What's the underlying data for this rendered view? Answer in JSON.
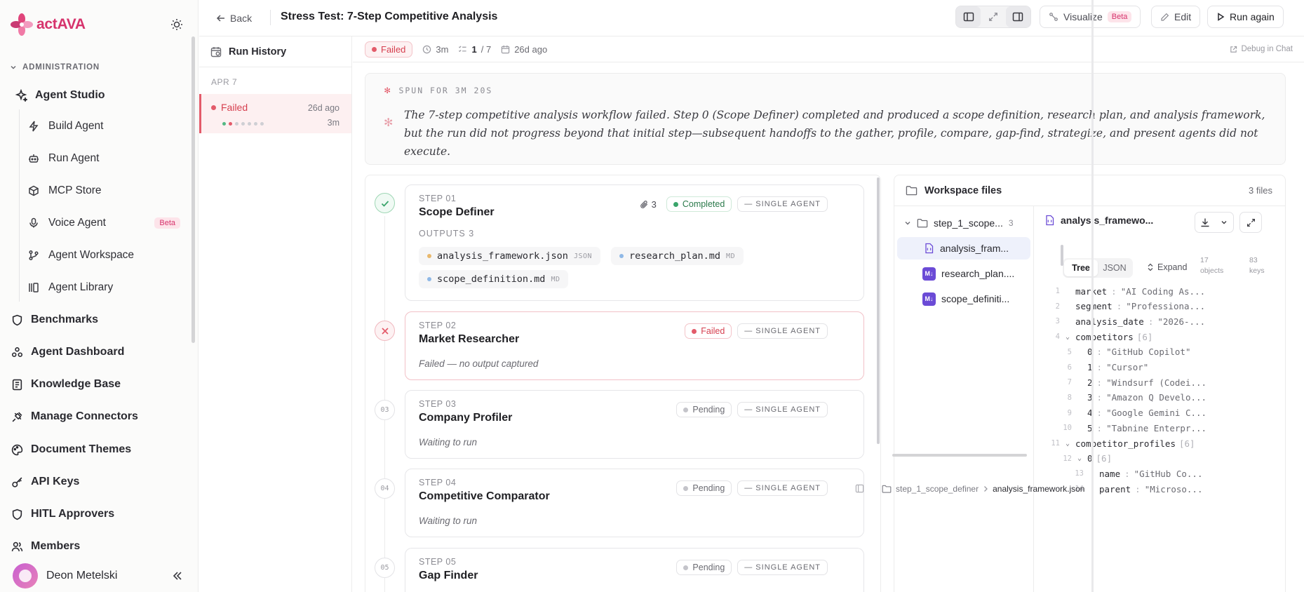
{
  "brand": {
    "name_part1": "act",
    "name_part2": "AVA",
    "accent": "#d6336c"
  },
  "sidebar": {
    "section_label": "ADMINISTRATION",
    "agent_studio_label": "Agent Studio",
    "sub_items": [
      {
        "label": "Build Agent",
        "icon": "bolt-icon"
      },
      {
        "label": "Run Agent",
        "icon": "robot-icon"
      },
      {
        "label": "MCP Store",
        "icon": "cube-icon"
      },
      {
        "label": "Voice Agent",
        "icon": "mic-icon",
        "badge": "Beta"
      },
      {
        "label": "Agent Workspace",
        "icon": "branch-icon"
      },
      {
        "label": "Agent Library",
        "icon": "library-icon"
      }
    ],
    "items": [
      {
        "label": "Benchmarks",
        "icon": "shield-icon"
      },
      {
        "label": "Agent Dashboard",
        "icon": "dashboard-icon"
      },
      {
        "label": "Knowledge Base",
        "icon": "book-icon"
      },
      {
        "label": "Manage Connectors",
        "icon": "plug-icon"
      },
      {
        "label": "Document Themes",
        "icon": "palette-icon"
      },
      {
        "label": "API Keys",
        "icon": "key-icon"
      },
      {
        "label": "HITL Approvers",
        "icon": "shield-check-icon"
      },
      {
        "label": "Members",
        "icon": "users-icon"
      }
    ],
    "user_name": "Deon Metelski"
  },
  "topbar": {
    "back_label": "Back",
    "title": "Stress Test: 7-Step Competitive Analysis",
    "visualize_label": "Visualize",
    "visualize_badge": "Beta",
    "edit_label": "Edit",
    "run_again_label": "Run again"
  },
  "run_history": {
    "title": "Run History",
    "date_group": "APR 7",
    "run": {
      "status": "Failed",
      "age": "26d ago",
      "duration": "3m"
    }
  },
  "run_meta": {
    "status": "Failed",
    "duration": "3m",
    "steps_done": "1",
    "steps_total": "/ 7",
    "age": "26d ago",
    "debug_label": "Debug in Chat"
  },
  "summary": {
    "heading": "SPUN FOR 3M 20S",
    "text": "The 7-step competitive analysis workflow failed. Step 0 (Scope Definer) completed and produced a scope definition, research plan, and analysis framework, but the run did not progress beyond that initial step—subsequent handoffs to the gather, profile, compare, gap-find, strategize, and present agents did not execute."
  },
  "steps": [
    {
      "num": "STEP 01",
      "name": "Scope Definer",
      "status": "Completed",
      "agent": "SINGLE AGENT",
      "attach_count": "3",
      "outputs_label": "OUTPUTS",
      "outputs_count": "3",
      "outputs": [
        {
          "name": "analysis_framework.json",
          "ext": "JSON",
          "color": "#e8b86d"
        },
        {
          "name": "research_plan.md",
          "ext": "MD",
          "color": "#8fb8e6"
        },
        {
          "name": "scope_definition.md",
          "ext": "MD",
          "color": "#8fb8e6"
        }
      ]
    },
    {
      "num": "STEP 02",
      "name": "Market Researcher",
      "status": "Failed",
      "agent": "SINGLE AGENT",
      "note": "Failed — no output captured"
    },
    {
      "num": "STEP 03",
      "name": "Company Profiler",
      "status": "Pending",
      "agent": "SINGLE AGENT",
      "note": "Waiting to run",
      "marker": "03"
    },
    {
      "num": "STEP 04",
      "name": "Competitive Comparator",
      "status": "Pending",
      "agent": "SINGLE AGENT",
      "note": "Waiting to run",
      "marker": "04"
    },
    {
      "num": "STEP 05",
      "name": "Gap Finder",
      "status": "Pending",
      "agent": "SINGLE AGENT",
      "marker": "05"
    }
  ],
  "workspace": {
    "title": "Workspace files",
    "count": "3 files",
    "folder": {
      "name": "step_1_scope...",
      "count": "3"
    },
    "files": [
      {
        "name": "analysis_fram...",
        "type": "json"
      },
      {
        "name": "research_plan....",
        "type": "md"
      },
      {
        "name": "scope_definiti...",
        "type": "md"
      }
    ],
    "viewer_title": "analysis_framewo...",
    "tab_tree": "Tree",
    "tab_json": "JSON",
    "expand_label": "Expand",
    "stat_objects_n": "17",
    "stat_objects_label": "objects",
    "stat_keys_n": "83",
    "stat_keys_label": "keys",
    "breadcrumb_folder": "step_1_scope_definer",
    "breadcrumb_file": "analysis_framework.json",
    "json_lines": [
      {
        "n": "1",
        "key": "market",
        "val": "\"AI Coding As..."
      },
      {
        "n": "2",
        "key": "segment",
        "val": "\"Professiona..."
      },
      {
        "n": "3",
        "key": "analysis_date",
        "val": "\"2026-..."
      },
      {
        "n": "4",
        "key": "competitors",
        "bracket": "[6]"
      },
      {
        "n": "5",
        "key": "0",
        "val": "\"GitHub Copilot\""
      },
      {
        "n": "6",
        "key": "1",
        "val": "\"Cursor\""
      },
      {
        "n": "7",
        "key": "2",
        "val": "\"Windsurf (Codei..."
      },
      {
        "n": "8",
        "key": "3",
        "val": "\"Amazon Q Develo..."
      },
      {
        "n": "9",
        "key": "4",
        "val": "\"Google Gemini C..."
      },
      {
        "n": "10",
        "key": "5",
        "val": "\"Tabnine Enterpr..."
      },
      {
        "n": "11",
        "key": "competitor_profiles",
        "bracket": "[6]"
      },
      {
        "n": "12",
        "key": "0",
        "bracket": "[6]"
      },
      {
        "n": "13",
        "key": "name",
        "val": "\"GitHub Co..."
      },
      {
        "n": "14",
        "key": "parent",
        "val": "\"Microso..."
      }
    ]
  }
}
